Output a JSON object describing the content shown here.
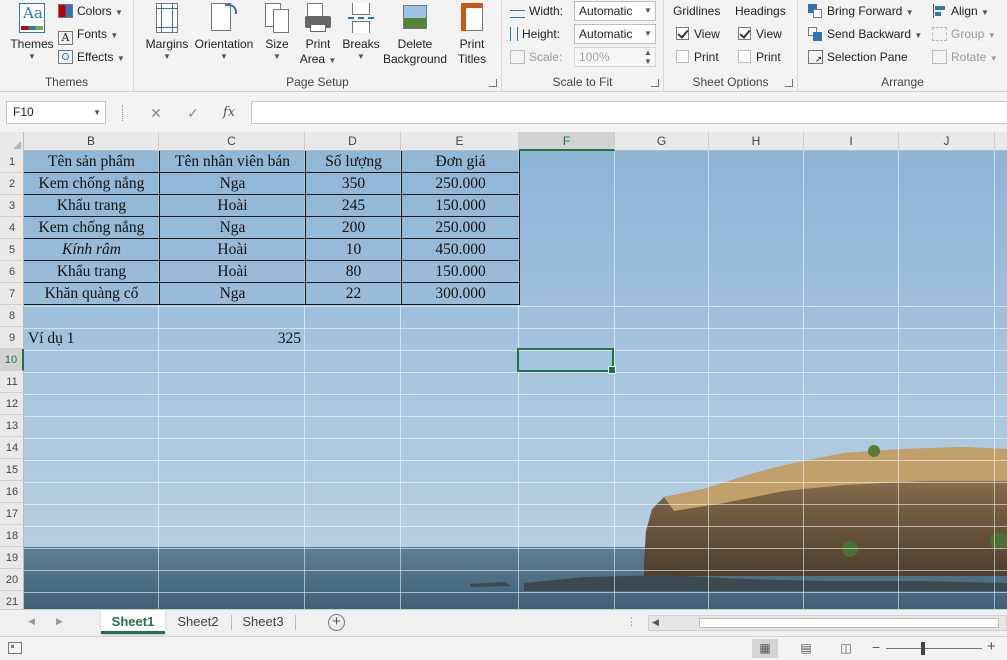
{
  "ribbon": {
    "themes": {
      "themes_label": "Themes",
      "colors_label": "Colors",
      "fonts_label": "Fonts",
      "effects_label": "Effects",
      "group_label": "Themes"
    },
    "page_setup": {
      "margins_label": "Margins",
      "orientation_label": "Orientation",
      "size_label": "Size",
      "print_area_line1": "Print",
      "print_area_line2": "Area",
      "breaks_label": "Breaks",
      "delete_bg_line1": "Delete",
      "delete_bg_line2": "Background",
      "print_titles_line1": "Print",
      "print_titles_line2": "Titles",
      "group_label": "Page Setup"
    },
    "scale_to_fit": {
      "width_label": "Width:",
      "width_value": "Automatic",
      "height_label": "Height:",
      "height_value": "Automatic",
      "scale_label": "Scale:",
      "scale_value": "100%",
      "group_label": "Scale to Fit"
    },
    "sheet_options": {
      "gridlines_label": "Gridlines",
      "headings_label": "Headings",
      "view_label": "View",
      "print_label": "Print",
      "group_label": "Sheet Options"
    },
    "arrange": {
      "bring_forward": "Bring Forward",
      "send_backward": "Send Backward",
      "selection_pane": "Selection Pane",
      "align": "Align",
      "group": "Group",
      "rotate": "Rotate",
      "group_label": "Arrange"
    }
  },
  "formula_bar": {
    "name_box": "F10",
    "cancel_glyph": "✕",
    "enter_glyph": "✓",
    "fx_glyph": "fx",
    "formula": ""
  },
  "grid": {
    "columns": [
      "B",
      "C",
      "D",
      "E",
      "F",
      "G",
      "H",
      "I",
      "J"
    ],
    "selected_column": "F",
    "rows": [
      "1",
      "2",
      "3",
      "4",
      "5",
      "6",
      "7",
      "8",
      "9",
      "10",
      "11",
      "12",
      "13",
      "14",
      "15",
      "16",
      "17",
      "18",
      "19",
      "20",
      "21"
    ],
    "selected_row": "10",
    "table": {
      "headers": [
        "Tên sản phẩm",
        "Tên nhân viên bán",
        "Số lượng",
        "Đơn giá"
      ],
      "rows": [
        [
          "Kem chống nắng",
          "Nga",
          "350",
          "250.000"
        ],
        [
          "Khẩu trang",
          "Hoài",
          "245",
          "150.000"
        ],
        [
          "Kem chống nắng",
          "Nga",
          "200",
          "250.000"
        ],
        [
          "Kính râm",
          "Hoài",
          "10",
          "450.000"
        ],
        [
          "Khẩu trang",
          "Hoài",
          "80",
          "150.000"
        ],
        [
          "Khăn quàng cổ",
          "Nga",
          "22",
          "300.000"
        ]
      ]
    },
    "example_label": "Ví dụ 1",
    "example_value": "325"
  },
  "sheets": {
    "tabs": [
      "Sheet1",
      "Sheet2",
      "Sheet3"
    ],
    "active": "Sheet1"
  },
  "colors": {
    "excel_green": "#217346",
    "ribbon_bg": "#f3f3f3"
  }
}
